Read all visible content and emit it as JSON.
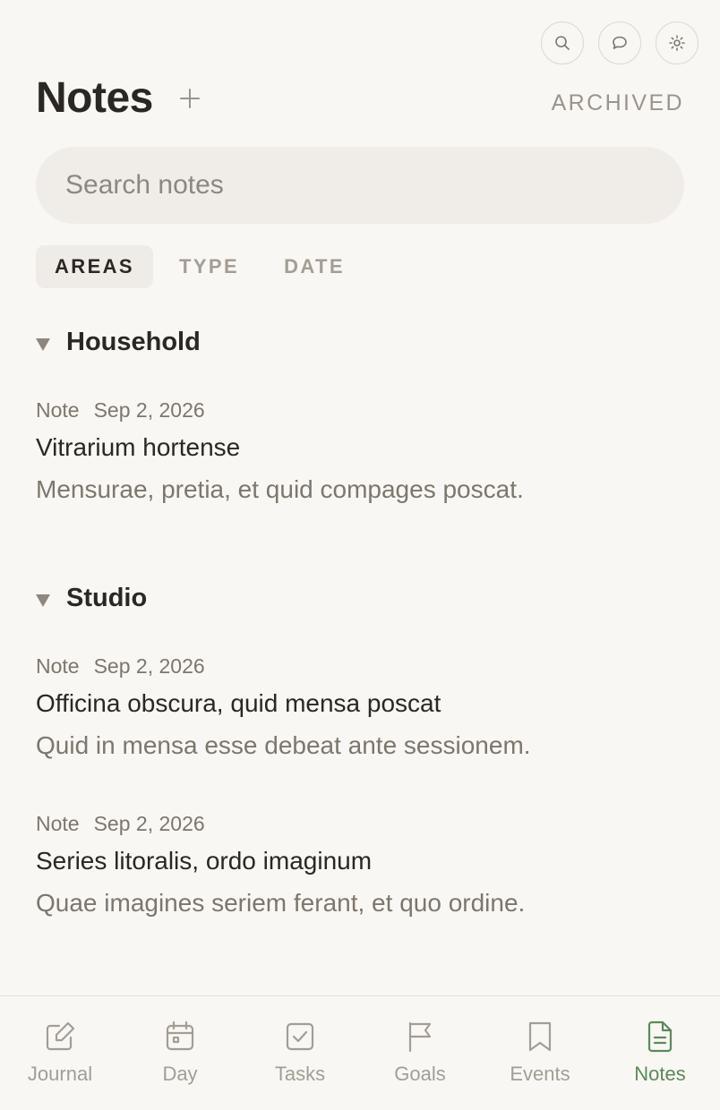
{
  "header": {
    "title": "Notes",
    "archived_label": "ARCHIVED"
  },
  "search": {
    "placeholder": "Search notes",
    "value": ""
  },
  "filters": [
    {
      "label": "AREAS",
      "active": true
    },
    {
      "label": "TYPE",
      "active": false
    },
    {
      "label": "DATE",
      "active": false
    }
  ],
  "groups": [
    {
      "name": "Household",
      "notes": [
        {
          "type": "Note",
          "date": "Sep 2, 2026",
          "title": "Vitrarium hortense",
          "body": "Mensurae, pretia, et quid compages poscat."
        }
      ]
    },
    {
      "name": "Studio",
      "notes": [
        {
          "type": "Note",
          "date": "Sep 2, 2026",
          "title": "Officina obscura, quid mensa poscat",
          "body": "Quid in mensa esse debeat ante sessionem."
        },
        {
          "type": "Note",
          "date": "Sep 2, 2026",
          "title": "Series litoralis, ordo imaginum",
          "body": "Quae imagines seriem ferant, et quo ordine."
        }
      ]
    }
  ],
  "nav": [
    {
      "label": "Journal",
      "icon": "edit-icon"
    },
    {
      "label": "Day",
      "icon": "calendar-icon"
    },
    {
      "label": "Tasks",
      "icon": "checkbox-icon"
    },
    {
      "label": "Goals",
      "icon": "flag-icon"
    },
    {
      "label": "Events",
      "icon": "bookmark-icon"
    },
    {
      "label": "Notes",
      "icon": "document-icon",
      "active": true
    }
  ],
  "colors": {
    "background": "#f9f7f3",
    "accent": "#5a8a5a",
    "muted": "#a39d95"
  }
}
